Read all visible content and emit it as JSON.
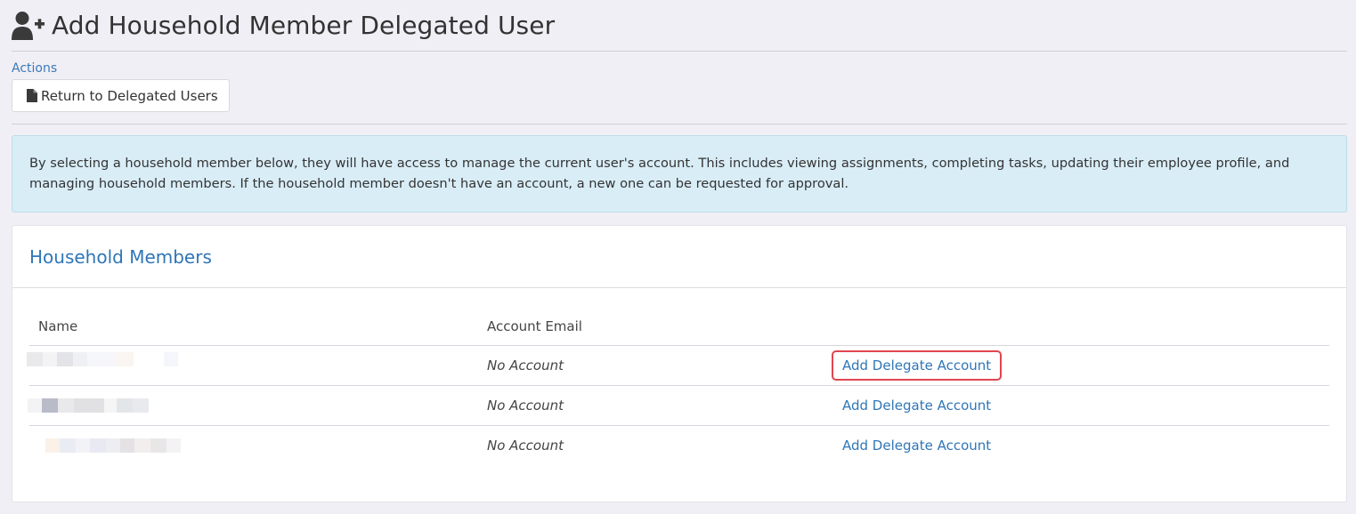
{
  "header": {
    "title": "Add Household Member Delegated User",
    "icon": "user-plus-icon"
  },
  "actions": {
    "label": "Actions",
    "return_button_label": "Return to Delegated Users",
    "return_button_icon": "file-icon"
  },
  "info": {
    "text": "By selecting a household member below, they will have access to manage the current user's account. This includes viewing assignments, completing tasks, updating their employee profile, and managing household members. If the household member doesn't have an account, a new one can be requested for approval."
  },
  "household_panel": {
    "title": "Household Members",
    "columns": [
      "Name",
      "Account Email",
      ""
    ],
    "rows": [
      {
        "email": "No Account",
        "action": "Add Delegate Account",
        "highlighted": true
      },
      {
        "email": "No Account",
        "action": "Add Delegate Account",
        "highlighted": false
      },
      {
        "email": "No Account",
        "action": "Add Delegate Account",
        "highlighted": false
      }
    ]
  },
  "colors": {
    "background": "#f0eff5",
    "link": "#2f76b7",
    "info_bg": "#d9edf7",
    "highlight": "#e0454f"
  }
}
